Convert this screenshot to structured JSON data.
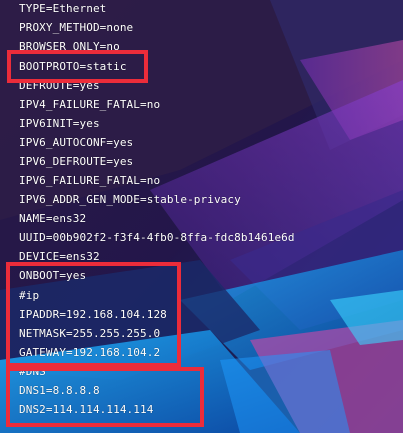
{
  "terminal": {
    "lines": [
      "TYPE=Ethernet",
      "PROXY_METHOD=none",
      "BROWSER_ONLY=no",
      "BOOTPROTO=static",
      "DEFROUTE=yes",
      "IPV4_FAILURE_FATAL=no",
      "IPV6INIT=yes",
      "IPV6_AUTOCONF=yes",
      "IPV6_DEFROUTE=yes",
      "IPV6_FAILURE_FATAL=no",
      "IPV6_ADDR_GEN_MODE=stable-privacy",
      "NAME=ens32",
      "UUID=00b902f2-f3f4-4fb0-8ffa-fdc8b1461e6d",
      "DEVICE=ens32",
      "ONBOOT=yes",
      "#ip",
      "IPADDR=192.168.104.128",
      "NETMASK=255.255.255.0",
      "GATEWAY=192.168.104.2",
      "#DNS",
      "DNS1=8.8.8.8",
      "DNS2=114.114.114.114"
    ]
  },
  "colors": {
    "text": "#ffffff",
    "highlight": "#ec2c3a",
    "background": "#1a1030"
  }
}
